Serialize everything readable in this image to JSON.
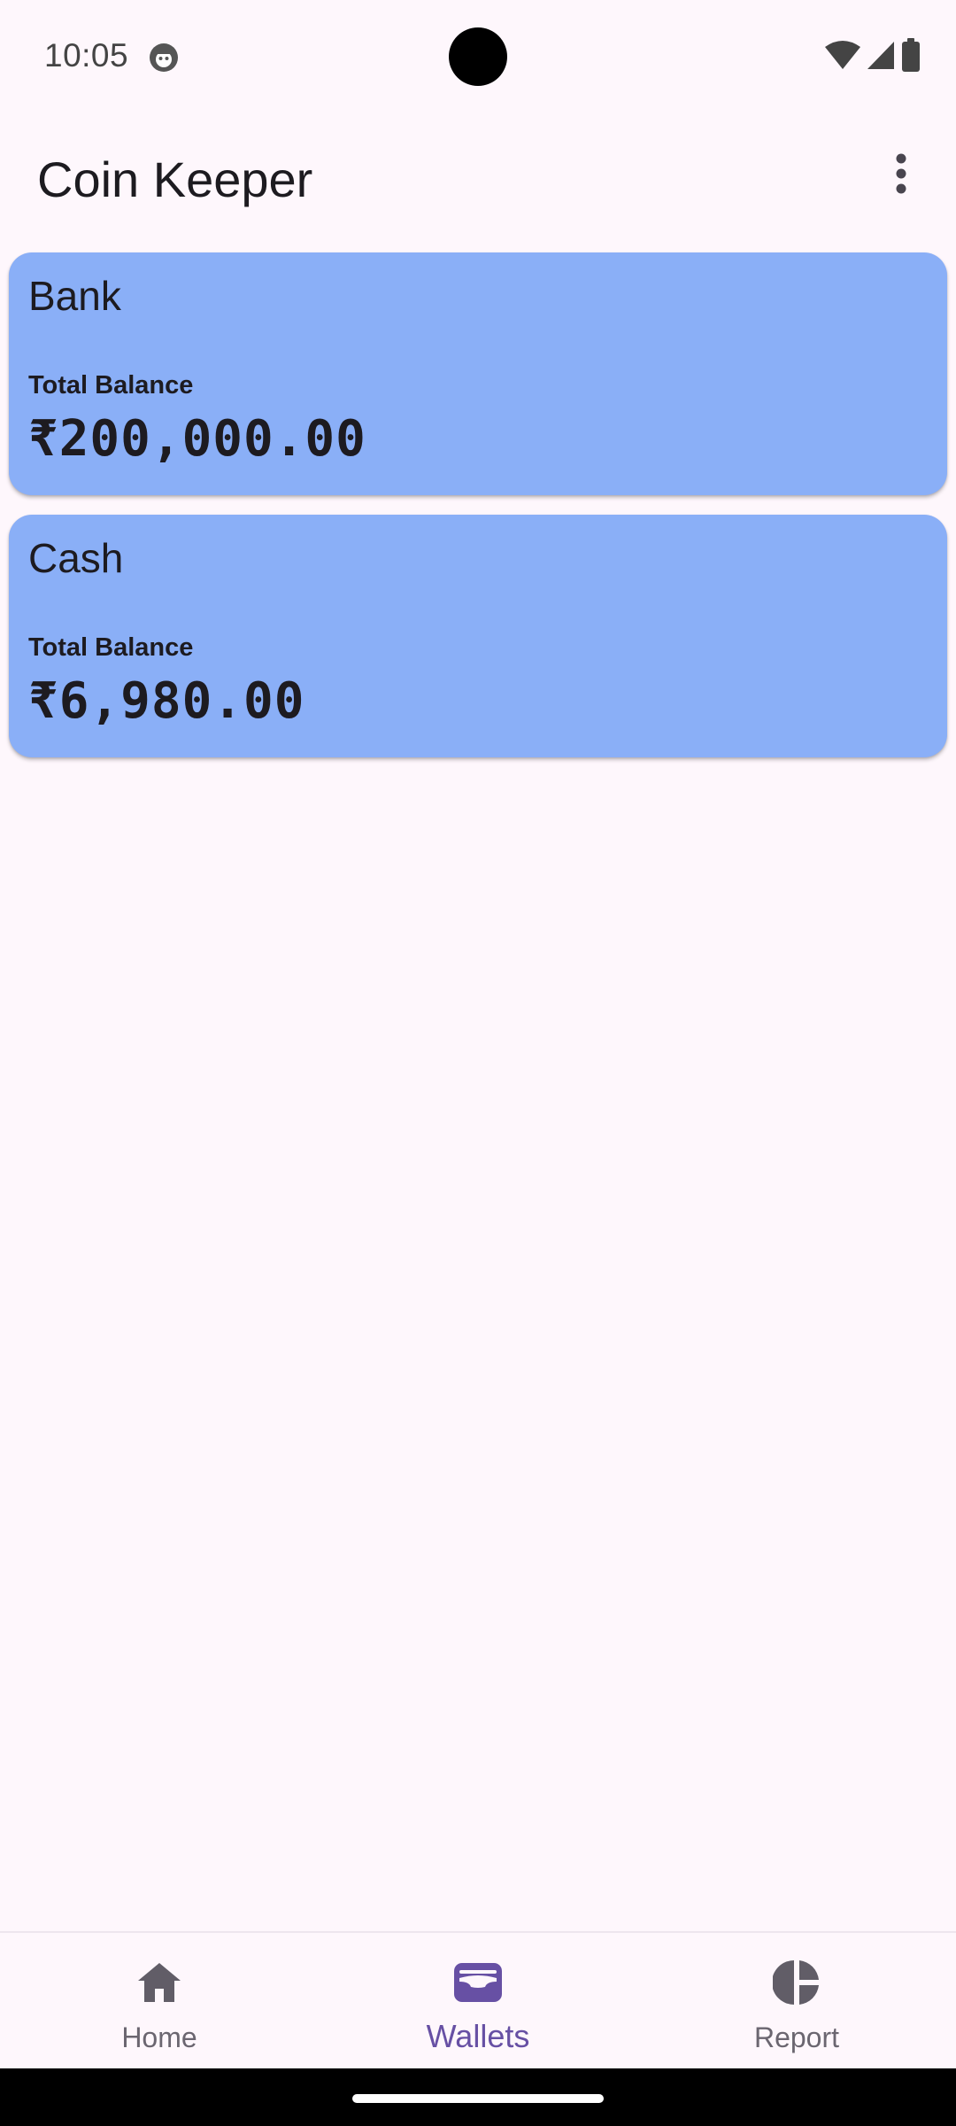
{
  "status_bar": {
    "time": "10:05",
    "icons": [
      "app-notification-icon",
      "wifi-icon",
      "cell-signal-icon",
      "battery-icon"
    ]
  },
  "app_bar": {
    "title": "Coin Keeper",
    "menu_icon": "more-vert-icon"
  },
  "wallets": [
    {
      "name": "Bank",
      "balance_label": "Total Balance",
      "balance": "₹200,000.00"
    },
    {
      "name": "Cash",
      "balance_label": "Total Balance",
      "balance": "₹6,980.00"
    }
  ],
  "bottom_nav": {
    "items": [
      {
        "label": "Home",
        "icon": "home-icon",
        "active": false
      },
      {
        "label": "Wallets",
        "icon": "wallet-icon",
        "active": true
      },
      {
        "label": "Report",
        "icon": "pie-chart-icon",
        "active": false
      }
    ]
  },
  "colors": {
    "background": "#fef7fc",
    "card": "#8aaff7",
    "accent": "#6750a4",
    "inactive": "#6b6670",
    "text": "#1d1b20"
  }
}
